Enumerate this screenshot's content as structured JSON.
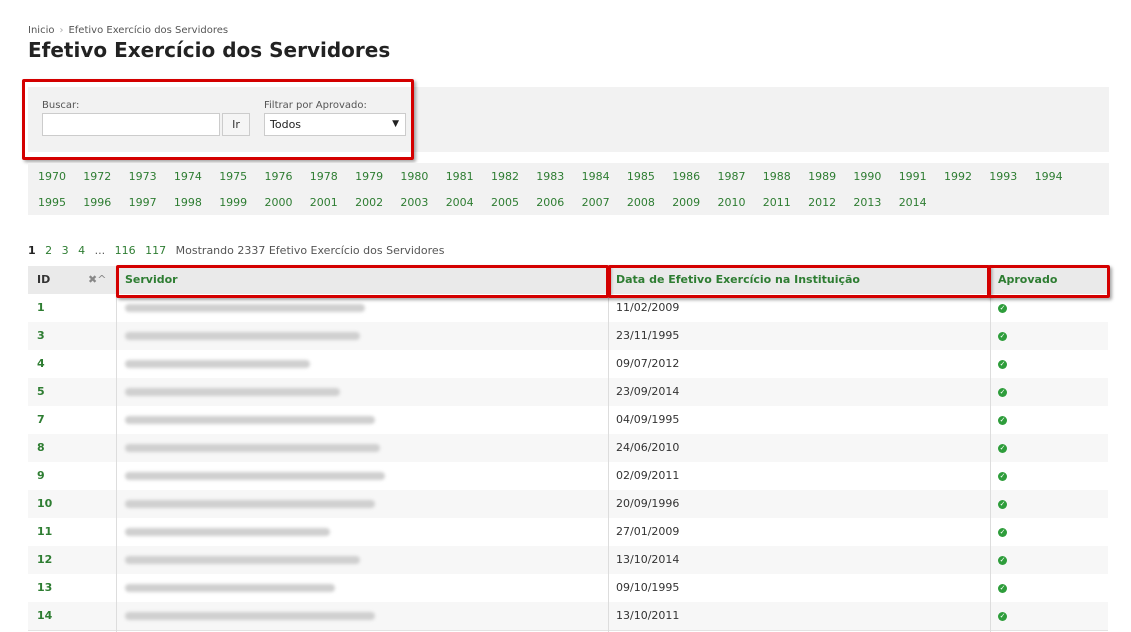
{
  "breadcrumb": {
    "home": "Inicio",
    "current": "Efetivo Exercício dos Servidores"
  },
  "page_title": "Efetivo Exercício dos Servidores",
  "filters": {
    "search_label": "Buscar:",
    "search_value": "",
    "go_label": "Ir",
    "approved_label": "Filtrar por Aprovado:",
    "approved_selected": "Todos"
  },
  "years": [
    "1970",
    "1972",
    "1973",
    "1974",
    "1975",
    "1976",
    "1978",
    "1979",
    "1980",
    "1981",
    "1982",
    "1983",
    "1984",
    "1985",
    "1986",
    "1987",
    "1988",
    "1989",
    "1990",
    "1991",
    "1992",
    "1993",
    "1994",
    "1995",
    "1996",
    "1997",
    "1998",
    "1999",
    "2000",
    "2001",
    "2002",
    "2003",
    "2004",
    "2005",
    "2006",
    "2007",
    "2008",
    "2009",
    "2010",
    "2011",
    "2012",
    "2013",
    "2014"
  ],
  "pagination": {
    "pages": [
      "1",
      "2",
      "3",
      "4",
      "...",
      "116",
      "117"
    ],
    "current": "1",
    "summary": "Mostrando 2337 Efetivo Exercício dos Servidores"
  },
  "table": {
    "headers": {
      "id": "ID",
      "servidor": "Servidor",
      "data": "Data de Efetivo Exercício na Instituição",
      "aprovado": "Aprovado"
    },
    "rows": [
      {
        "id": "1",
        "data": "11/02/2009",
        "approved": true
      },
      {
        "id": "3",
        "data": "23/11/1995",
        "approved": true
      },
      {
        "id": "4",
        "data": "09/07/2012",
        "approved": true
      },
      {
        "id": "5",
        "data": "23/09/2014",
        "approved": true
      },
      {
        "id": "7",
        "data": "04/09/1995",
        "approved": true
      },
      {
        "id": "8",
        "data": "24/06/2010",
        "approved": true
      },
      {
        "id": "9",
        "data": "02/09/2011",
        "approved": true
      },
      {
        "id": "10",
        "data": "20/09/1996",
        "approved": true
      },
      {
        "id": "11",
        "data": "27/01/2009",
        "approved": true
      },
      {
        "id": "12",
        "data": "13/10/2014",
        "approved": true
      },
      {
        "id": "13",
        "data": "09/10/1995",
        "approved": true
      },
      {
        "id": "14",
        "data": "13/10/2011",
        "approved": true
      }
    ]
  },
  "colors": {
    "accent_green": "#2e7d32",
    "highlight_red": "#d40000",
    "check_green": "#2e9d3b"
  },
  "icons": {
    "remove_sort": "close-icon",
    "sort_asc": "chevron-up-icon",
    "approved": "check-circle-icon",
    "select": "caret-down-icon"
  }
}
